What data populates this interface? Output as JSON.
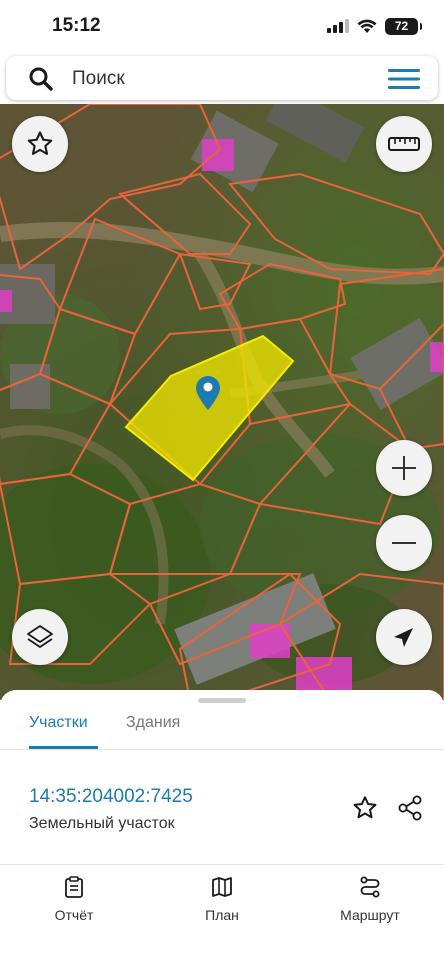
{
  "status": {
    "time": "15:12",
    "battery": "72"
  },
  "search": {
    "placeholder": "Поиск"
  },
  "sheet": {
    "tabs": [
      {
        "label": "Участки",
        "active": true
      },
      {
        "label": "Здания",
        "active": false
      }
    ],
    "parcel": {
      "number": "14:35:204002:7425",
      "type": "Земельный участок"
    }
  },
  "nav": [
    {
      "label": "Отчёт",
      "icon": "report-icon"
    },
    {
      "label": "План",
      "icon": "map-plan-icon"
    },
    {
      "label": "Маршрут",
      "icon": "route-icon"
    }
  ],
  "colors": {
    "accent": "#1c7bb0",
    "parcel_border": "#e8643a",
    "selected_parcel": "#f0e400",
    "building_highlight": "#e040c8"
  }
}
